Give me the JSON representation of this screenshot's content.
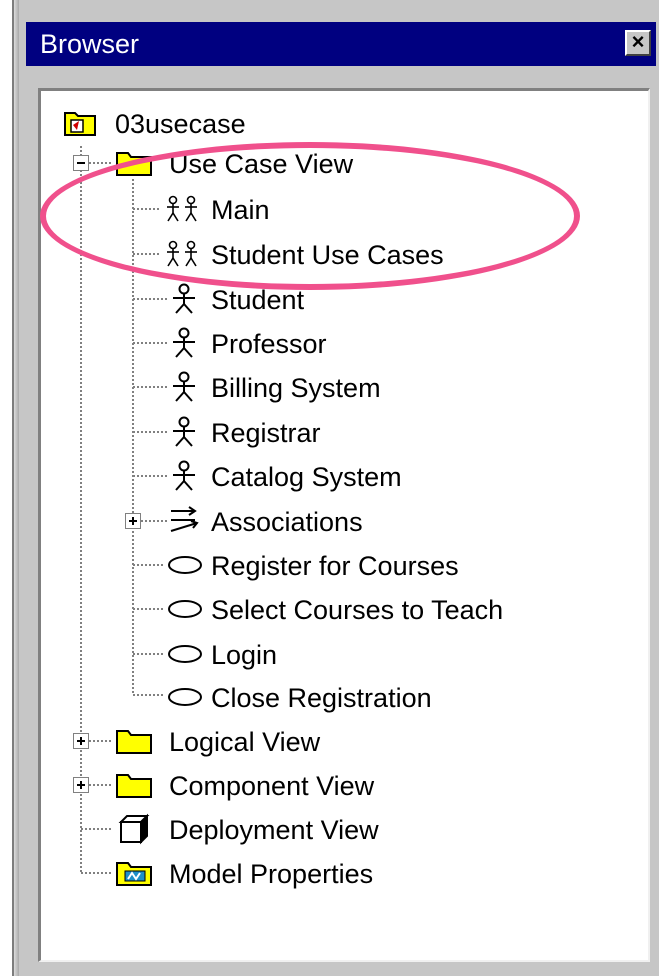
{
  "window": {
    "title": "Browser",
    "close_label": "×"
  },
  "tree": {
    "root": {
      "label": "03usecase",
      "icon": "model-folder-icon"
    },
    "use_case_view": {
      "label": "Use Case View",
      "icon": "folder-icon",
      "expanded": true,
      "children": [
        {
          "label": "Main",
          "icon": "use-case-diagram-icon"
        },
        {
          "label": "Student Use Cases",
          "icon": "use-case-diagram-icon"
        },
        {
          "label": "Student",
          "icon": "actor-icon"
        },
        {
          "label": "Professor",
          "icon": "actor-icon"
        },
        {
          "label": "Billing System",
          "icon": "actor-icon"
        },
        {
          "label": "Registrar",
          "icon": "actor-icon"
        },
        {
          "label": "Catalog System",
          "icon": "actor-icon"
        },
        {
          "label": "Associations",
          "icon": "associations-icon",
          "expandable": true
        },
        {
          "label": "Register for Courses",
          "icon": "use-case-icon"
        },
        {
          "label": "Select Courses to Teach",
          "icon": "use-case-icon"
        },
        {
          "label": "Login",
          "icon": "use-case-icon"
        },
        {
          "label": "Close Registration",
          "icon": "use-case-icon"
        }
      ]
    },
    "logical_view": {
      "label": "Logical View",
      "icon": "folder-icon",
      "expandable": true
    },
    "component_view": {
      "label": "Component View",
      "icon": "folder-icon",
      "expandable": true
    },
    "deployment_view": {
      "label": "Deployment View",
      "icon": "deployment-cube-icon"
    },
    "model_properties": {
      "label": "Model Properties",
      "icon": "model-properties-icon"
    }
  },
  "colors": {
    "titlebar": "#000080",
    "highlight": "#f0508c",
    "folder": "#ffff00"
  }
}
